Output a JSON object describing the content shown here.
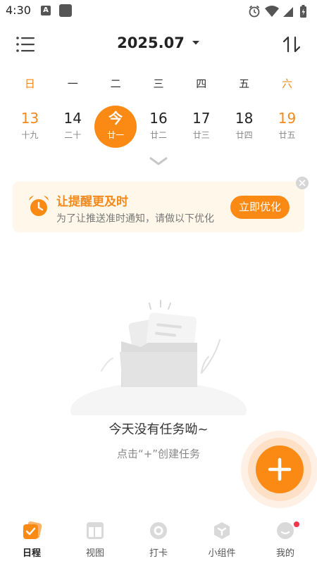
{
  "status_bar": {
    "time": "4:30",
    "a_badge": "A"
  },
  "header": {
    "month": "2025.07",
    "menu_icon": "list-menu-icon",
    "sort_icon": "sort-up-down-icon"
  },
  "weekdays": [
    "日",
    "一",
    "二",
    "三",
    "四",
    "五",
    "六"
  ],
  "dates": [
    {
      "day": "13",
      "lunar": "十九"
    },
    {
      "day": "14",
      "lunar": "二十"
    },
    {
      "day": "今",
      "lunar": "廿一"
    },
    {
      "day": "16",
      "lunar": "廿二"
    },
    {
      "day": "17",
      "lunar": "廿三"
    },
    {
      "day": "18",
      "lunar": "廿四"
    },
    {
      "day": "19",
      "lunar": "廿五"
    }
  ],
  "reminder": {
    "title": "让提醒更及时",
    "description": "为了让推送准时通知，请做以下优化",
    "button": "立即优化"
  },
  "empty_state": {
    "title": "今天没有任务呦~",
    "subtitle": "点击“+”创建任务"
  },
  "nav": [
    {
      "label": "日程",
      "icon": "schedule-icon"
    },
    {
      "label": "视图",
      "icon": "view-icon"
    },
    {
      "label": "打卡",
      "icon": "checkin-icon"
    },
    {
      "label": "小组件",
      "icon": "widget-icon"
    },
    {
      "label": "我的",
      "icon": "profile-icon"
    }
  ],
  "colors": {
    "accent": "#fb8a15",
    "weekend": "#f5891a",
    "card_bg": "#fff8ea",
    "notification_dot": "#f5344a"
  }
}
